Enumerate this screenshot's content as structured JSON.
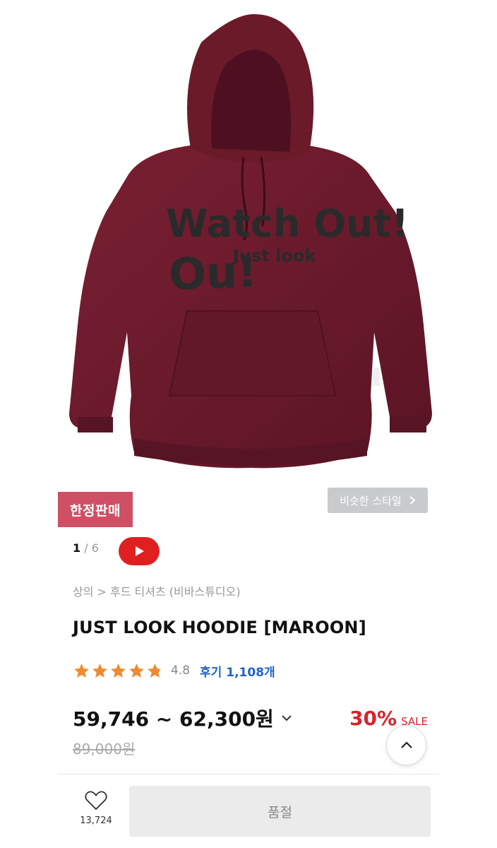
{
  "product": {
    "image_alt": "Maroon hoodie product photo",
    "print_text_line1": "Watch Out!",
    "print_text_line2": "Just look",
    "limited_badge": "한정판매",
    "similar_style_label": "비슷한 스타일",
    "pager": {
      "current": "1",
      "total": "6",
      "separator": "/"
    },
    "breadcrumb": "상의 > 후드 티셔츠 (비바스튜디오)",
    "title": "JUST LOOK HOODIE [MAROON]",
    "rating": {
      "stars": 4.8,
      "value": "4.8"
    },
    "reviews_label": "후기 1,108개",
    "price_range": "59,746 ~ 62,300원",
    "discount_pct": "30%",
    "sale_label": "SALE",
    "original_price": "89,000원"
  },
  "bottom_bar": {
    "wish_count": "13,724",
    "soldout_label": "품절"
  },
  "colors": {
    "badge": "#cf4f64",
    "accent_red": "#d6242a",
    "link_blue": "#1f63c8",
    "star_orange": "#f08a30",
    "hoodie_maroon": "#6b1a2a"
  },
  "icons": {
    "youtube": "youtube-play-icon",
    "chevron_right": "chevron-right-icon",
    "chevron_down": "chevron-down-icon",
    "chevron_up": "chevron-up-icon",
    "heart": "heart-outline-icon",
    "star": "star-icon"
  }
}
